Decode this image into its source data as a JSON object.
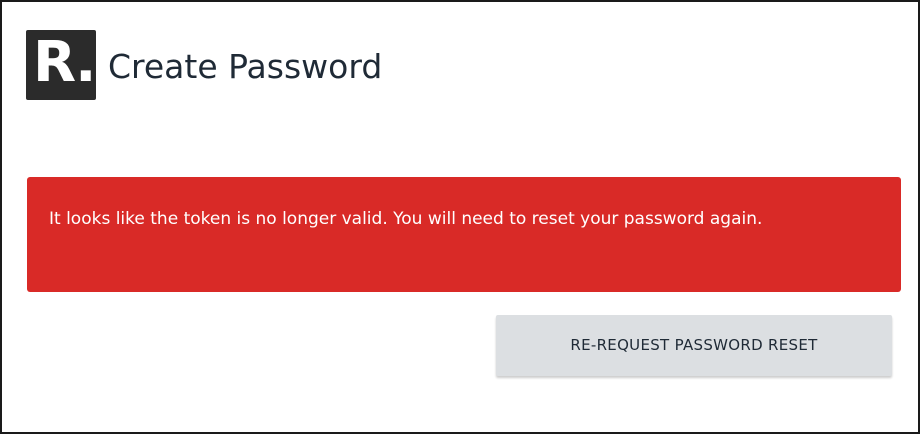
{
  "header": {
    "logo_text": "R.",
    "title": "Create Password"
  },
  "alert": {
    "message": "It looks like the token is no longer valid. You will need to reset your password again.",
    "color": "#d92a27"
  },
  "actions": {
    "rerequest_label": "RE-REQUEST PASSWORD RESET"
  }
}
